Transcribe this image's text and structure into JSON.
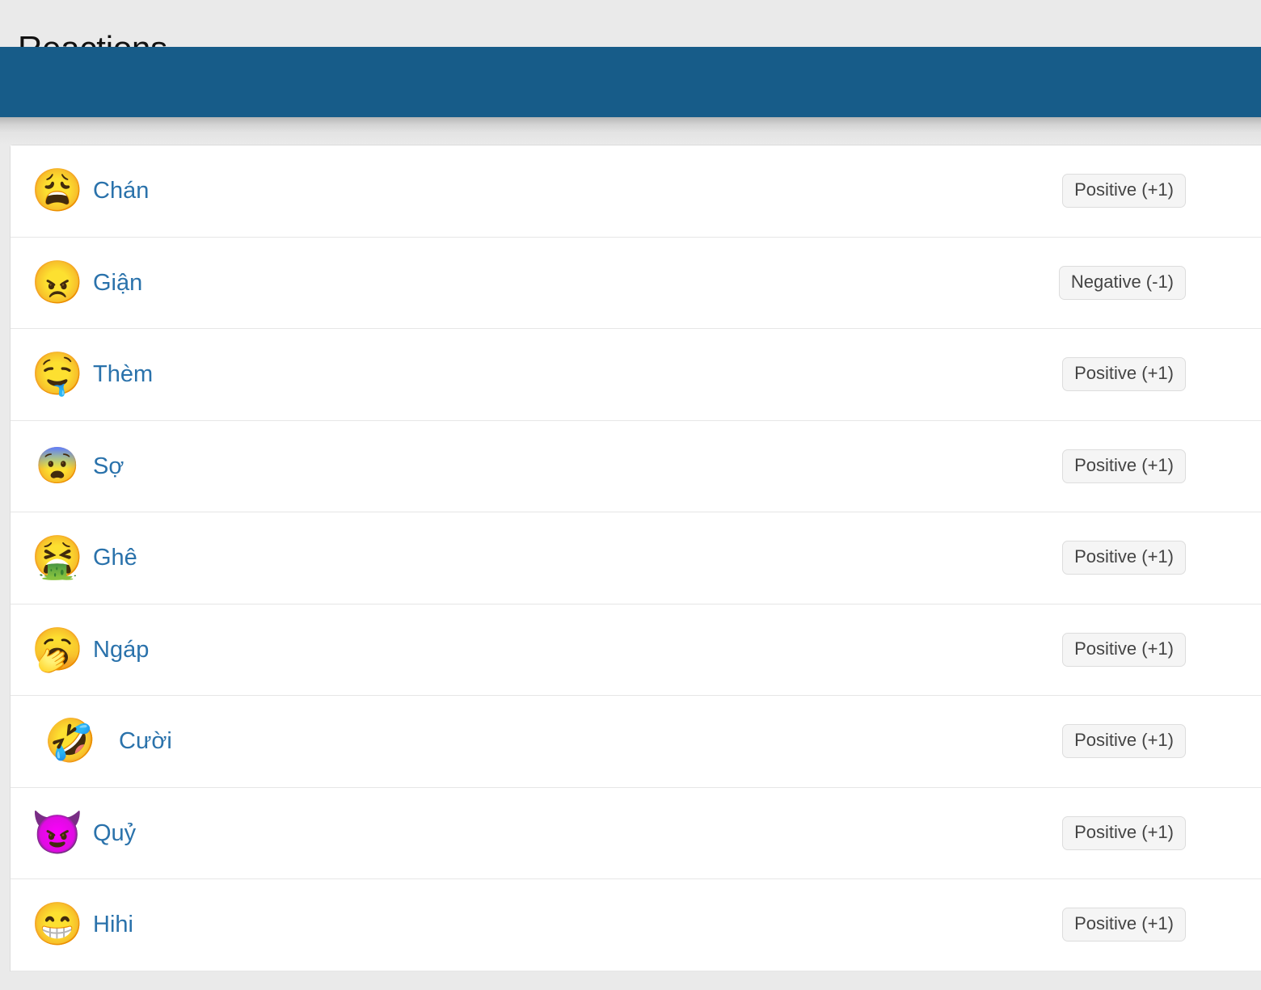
{
  "page": {
    "title": "Reactions",
    "accent_color": "#175c89",
    "link_color": "#2a72ab",
    "background_color": "#eaeaea",
    "card_background": "#ffffff",
    "badge_background": "#f5f5f5",
    "badge_border_color": "#dddddd"
  },
  "reactions": [
    {
      "icon": "weary-face-emoji",
      "glyph": "😩",
      "label": "Chán",
      "badge": "Positive (+1)",
      "value": "+1",
      "sentiment": "Positive"
    },
    {
      "icon": "angry-face-emoji",
      "glyph": "😠",
      "label": "Giận",
      "badge": "Negative (-1)",
      "value": "-1",
      "sentiment": "Negative"
    },
    {
      "icon": "drooling-face-emoji",
      "glyph": "🤤",
      "label": "Thèm",
      "badge": "Positive (+1)",
      "value": "+1",
      "sentiment": "Positive"
    },
    {
      "icon": "fearful-face-emoji",
      "glyph": "😨",
      "label": "Sợ",
      "badge": "Positive (+1)",
      "value": "+1",
      "sentiment": "Positive"
    },
    {
      "icon": "face-vomiting-emoji",
      "glyph": "🤮",
      "label": "Ghê",
      "badge": "Positive (+1)",
      "value": "+1",
      "sentiment": "Positive"
    },
    {
      "icon": "yawning-face-emoji",
      "glyph": "🥱",
      "label": "Ngáp",
      "badge": "Positive (+1)",
      "value": "+1",
      "sentiment": "Positive"
    },
    {
      "icon": "rolling-on-floor-laughing-emoji",
      "glyph": "🤣",
      "label": "Cười",
      "badge": "Positive (+1)",
      "value": "+1",
      "sentiment": "Positive"
    },
    {
      "icon": "smiling-face-with-horns-emoji",
      "glyph": "😈",
      "label": "Quỷ",
      "badge": "Positive (+1)",
      "value": "+1",
      "sentiment": "Positive"
    },
    {
      "icon": "grinning-face-big-eyes-emoji",
      "glyph": "😁",
      "label": "Hihi",
      "badge": "Positive (+1)",
      "value": "+1",
      "sentiment": "Positive"
    }
  ]
}
